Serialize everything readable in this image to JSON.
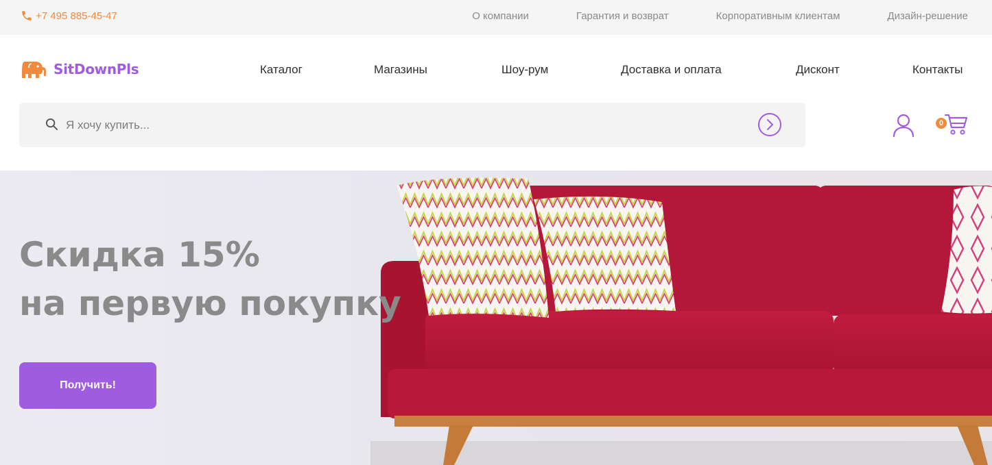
{
  "topbar": {
    "phone": "+7 495 885-45-47",
    "links": [
      "О компании",
      "Гарантия и возврат",
      "Корпоративным клиентам",
      "Дизайн-решение"
    ]
  },
  "header": {
    "logo": "SitDownPls",
    "nav": [
      "Каталог",
      "Магазины",
      "Шоу-рум",
      "Доставка и оплата",
      "Дисконт",
      "Контакты"
    ]
  },
  "search": {
    "placeholder": "Я хочу купить..."
  },
  "cart": {
    "count": "0"
  },
  "hero": {
    "title_line1": "Скидка 15%",
    "title_line2": "на первую покупку",
    "button": "Получить!"
  },
  "colors": {
    "accent": "#a05ce0",
    "orange": "#f08a3c",
    "sofa": "#b8193a"
  },
  "icons": [
    "phone-icon",
    "elephant-logo-icon",
    "search-icon",
    "chevron-right-circle-icon",
    "user-icon",
    "cart-icon"
  ]
}
